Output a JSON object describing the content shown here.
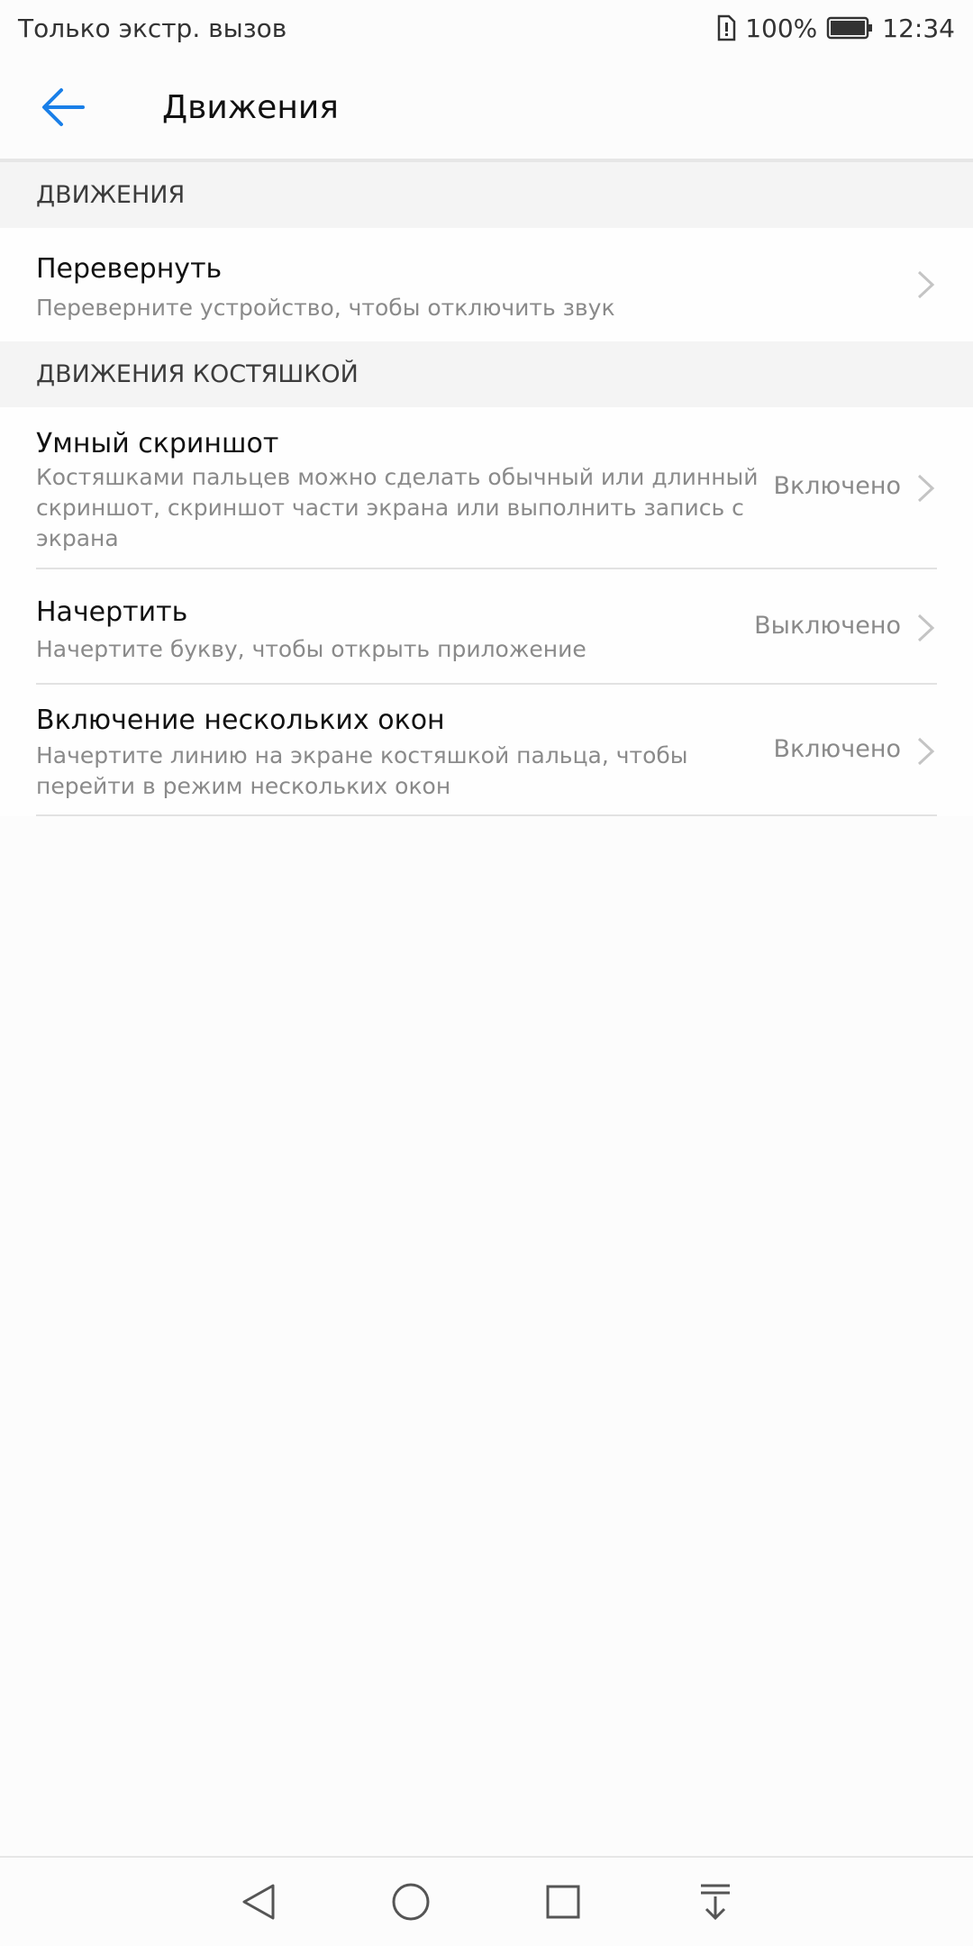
{
  "status_bar": {
    "carrier_text": "Только экстр. вызов",
    "battery_percent": "100%",
    "time": "12:34"
  },
  "header": {
    "title": "Движения"
  },
  "sections": [
    {
      "header": "ДВИЖЕНИЯ",
      "items": [
        {
          "title": "Перевернуть",
          "subtitle_lines": [
            "Переверните устройство, чтобы отключить звук"
          ],
          "status": ""
        }
      ]
    },
    {
      "header": "ДВИЖЕНИЯ КОСТЯШКОЙ",
      "items": [
        {
          "title": "Умный скриншот",
          "subtitle_lines": [
            "Костяшками пальцев можно сделать обычный или длинный",
            "скриншот, скриншот части экрана или выполнить запись с",
            "экрана"
          ],
          "status": "Включено"
        },
        {
          "title": "Начертить",
          "subtitle_lines": [
            "Начертите букву, чтобы открыть приложение"
          ],
          "status": "Выключено"
        },
        {
          "title": "Включение нескольких окон",
          "subtitle_lines": [
            "Начертите линию на экране костяшкой пальца, чтобы",
            "перейти в режим нескольких окон"
          ],
          "status": "Включено"
        }
      ]
    }
  ],
  "colors": {
    "accent": "#1a7fe8",
    "chevron": "#c4c4c4",
    "section_bg": "#f4f4f4"
  },
  "icons": {
    "back": "arrow-left-icon",
    "chevron": "chevron-right-icon",
    "nav_back": "triangle-back-icon",
    "nav_home": "circle-home-icon",
    "nav_recents": "square-recents-icon",
    "nav_notifications": "download-notifications-icon"
  }
}
